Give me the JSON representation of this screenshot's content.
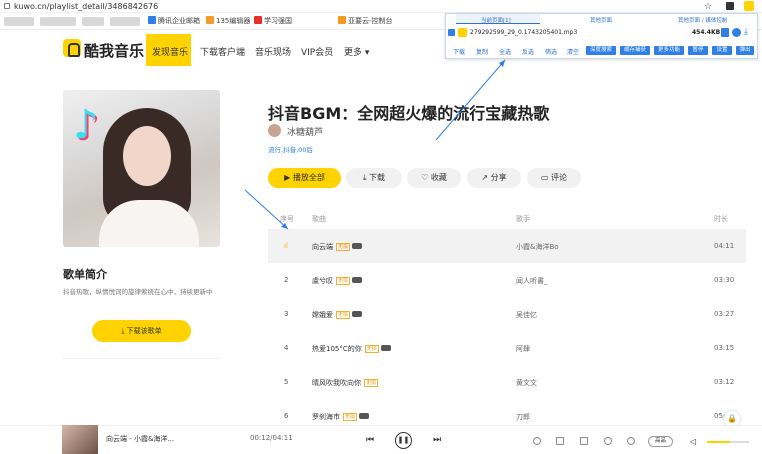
{
  "browser": {
    "url": "kuwo.cn/playlist_detail/3486842676"
  },
  "bookmarks": [
    "腾讯企业邮箱",
    "135编辑器",
    "学习强国",
    "亚要云-控制台"
  ],
  "header": {
    "logo": "酷我音乐",
    "nav": [
      "发现音乐",
      "下载客户端",
      "音乐现场",
      "VIP会员",
      "更多"
    ]
  },
  "extension": {
    "tabs": [
      "当前页面[1]",
      "其他页面",
      "其他页面 / 媒体控制"
    ],
    "file": "279292599_29_0.1743205401.mp3",
    "size": "454.4KB",
    "links": [
      "下载",
      "复制",
      "全选",
      "反选",
      "筛选",
      "清空"
    ],
    "buttons": [
      "深度搜索",
      "缓存捕获",
      "更多功能",
      "暂停",
      "设置",
      "弹出"
    ]
  },
  "playlist": {
    "title": "抖音BGM：全网超火爆的流行宝藏热歌",
    "author": "冰糖葫芦",
    "tags": "流行,抖音,00后",
    "actions": [
      "播放全部",
      "下载",
      "收藏",
      "分享",
      "评论"
    ],
    "intro_title": "歌单简介",
    "intro_text": "抖音热歌，纵情悦词的旋律萦绕在心中，持续更新中",
    "download_label": "下载该歌单",
    "columns": [
      "序号",
      "歌曲",
      "歌手",
      "时长"
    ],
    "tracks": [
      {
        "idx": "",
        "name": "向云端",
        "singer": "小霞&海洋Bo",
        "duration": "04:11",
        "tag": "无损"
      },
      {
        "idx": "2",
        "name": "虞兮叹",
        "singer": "闻人听書_",
        "duration": "03:30",
        "tag": "无损"
      },
      {
        "idx": "3",
        "name": "嫦娥爱",
        "singer": "吴佳忆",
        "duration": "03:27",
        "tag": "无损"
      },
      {
        "idx": "4",
        "name": "热爱105°C的你",
        "singer": "阿肆",
        "duration": "03:15",
        "tag": "无损"
      },
      {
        "idx": "5",
        "name": "晴风吹我吹向你",
        "singer": "黄文文",
        "duration": "03:12",
        "tag": "无损"
      },
      {
        "idx": "6",
        "name": "罗刹海市",
        "singer": "刀郎",
        "duration": "05:",
        "tag": "无损"
      }
    ]
  },
  "player": {
    "title": "向云端 - 小霞&海洋...",
    "time": "00:12/04:11",
    "quality": "高品",
    "volume": 0.55
  },
  "colors": {
    "accent": "#ffd300",
    "link": "#2e6fcf"
  }
}
